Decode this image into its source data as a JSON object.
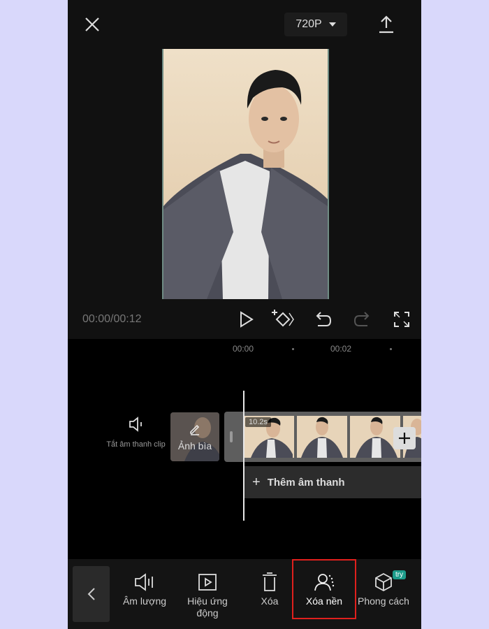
{
  "header": {
    "resolution": "720P"
  },
  "playback": {
    "timecode": "00:00/00:12"
  },
  "ruler": {
    "tick_1": "00:00",
    "tick_2": "00:02"
  },
  "timeline": {
    "mute_label": "Tắt âm thanh clip",
    "cover_label": "Ảnh bìa",
    "clip_duration": "10.2s",
    "add_audio_label": "Thêm âm thanh"
  },
  "toolbar": {
    "items": [
      {
        "label": "Âm lượng",
        "icon": "volume-icon"
      },
      {
        "label": "Hiệu ứng động",
        "icon": "animation-icon"
      },
      {
        "label": "Xóa",
        "icon": "delete-icon"
      },
      {
        "label": "Xóa nền",
        "icon": "remove-background-icon"
      },
      {
        "label": "Phong cách",
        "icon": "style-icon"
      }
    ],
    "try_badge": "try",
    "selected_item": "Xóa nền"
  },
  "colors": {
    "highlight": "#e0201d",
    "try_badge": "#1d9c8b",
    "background": "#d9d8fb"
  }
}
